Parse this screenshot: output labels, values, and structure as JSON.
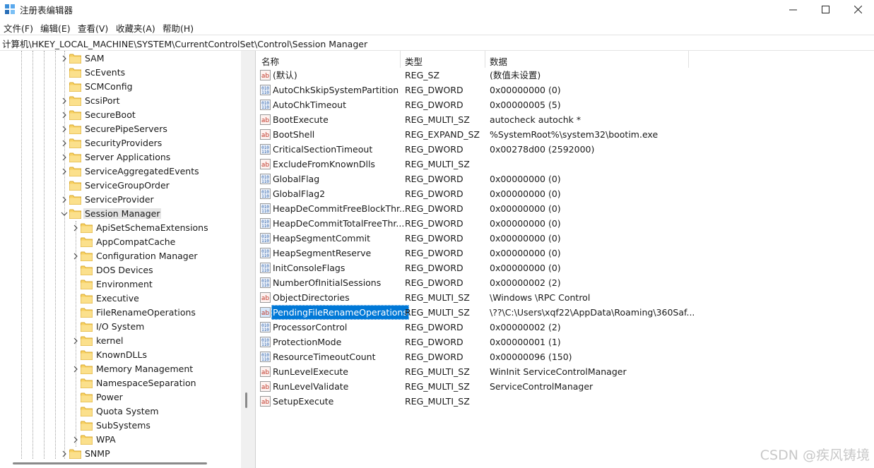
{
  "window": {
    "title": "注册表编辑器",
    "controls": [
      "minimize-icon",
      "maximize-icon",
      "close-icon"
    ]
  },
  "menu": [
    "文件(F)",
    "编辑(E)",
    "查看(V)",
    "收藏夹(A)",
    "帮助(H)"
  ],
  "address": "计算机\\HKEY_LOCAL_MACHINE\\SYSTEM\\CurrentControlSet\\Control\\Session Manager",
  "tree": [
    {
      "label": "SAM",
      "expandable": true,
      "level": 1
    },
    {
      "label": "ScEvents",
      "expandable": false,
      "level": 1
    },
    {
      "label": "SCMConfig",
      "expandable": false,
      "level": 1
    },
    {
      "label": "ScsiPort",
      "expandable": true,
      "level": 1
    },
    {
      "label": "SecureBoot",
      "expandable": true,
      "level": 1
    },
    {
      "label": "SecurePipeServers",
      "expandable": true,
      "level": 1
    },
    {
      "label": "SecurityProviders",
      "expandable": true,
      "level": 1
    },
    {
      "label": "Server Applications",
      "expandable": true,
      "level": 1
    },
    {
      "label": "ServiceAggregatedEvents",
      "expandable": true,
      "level": 1
    },
    {
      "label": "ServiceGroupOrder",
      "expandable": false,
      "level": 1
    },
    {
      "label": "ServiceProvider",
      "expandable": true,
      "level": 1
    },
    {
      "label": "Session Manager",
      "expandable": true,
      "expanded": true,
      "selected": true,
      "level": 1
    },
    {
      "label": "ApiSetSchemaExtensions",
      "expandable": true,
      "level": 2
    },
    {
      "label": "AppCompatCache",
      "expandable": false,
      "level": 2
    },
    {
      "label": "Configuration Manager",
      "expandable": true,
      "level": 2
    },
    {
      "label": "DOS Devices",
      "expandable": false,
      "level": 2
    },
    {
      "label": "Environment",
      "expandable": false,
      "level": 2
    },
    {
      "label": "Executive",
      "expandable": false,
      "level": 2
    },
    {
      "label": "FileRenameOperations",
      "expandable": false,
      "level": 2
    },
    {
      "label": "I/O System",
      "expandable": false,
      "level": 2
    },
    {
      "label": "kernel",
      "expandable": true,
      "level": 2
    },
    {
      "label": "KnownDLLs",
      "expandable": false,
      "level": 2
    },
    {
      "label": "Memory Management",
      "expandable": true,
      "level": 2
    },
    {
      "label": "NamespaceSeparation",
      "expandable": false,
      "level": 2
    },
    {
      "label": "Power",
      "expandable": false,
      "level": 2
    },
    {
      "label": "Quota System",
      "expandable": false,
      "level": 2
    },
    {
      "label": "SubSystems",
      "expandable": false,
      "level": 2
    },
    {
      "label": "WPA",
      "expandable": true,
      "level": 2
    },
    {
      "label": "SNMP",
      "expandable": true,
      "level": 1
    }
  ],
  "columns": {
    "name": "名称",
    "type": "类型",
    "data": "数据"
  },
  "values": [
    {
      "name": "(默认)",
      "type": "REG_SZ",
      "data": "(数值未设置)",
      "icon": "string-value-icon"
    },
    {
      "name": "AutoChkSkipSystemPartition",
      "type": "REG_DWORD",
      "data": "0x00000000 (0)",
      "icon": "binary-value-icon"
    },
    {
      "name": "AutoChkTimeout",
      "type": "REG_DWORD",
      "data": "0x00000005 (5)",
      "icon": "binary-value-icon"
    },
    {
      "name": "BootExecute",
      "type": "REG_MULTI_SZ",
      "data": "autocheck autochk *",
      "icon": "string-value-icon"
    },
    {
      "name": "BootShell",
      "type": "REG_EXPAND_SZ",
      "data": "%SystemRoot%\\system32\\bootim.exe",
      "icon": "string-value-icon"
    },
    {
      "name": "CriticalSectionTimeout",
      "type": "REG_DWORD",
      "data": "0x00278d00 (2592000)",
      "icon": "binary-value-icon"
    },
    {
      "name": "ExcludeFromKnownDlls",
      "type": "REG_MULTI_SZ",
      "data": "",
      "icon": "string-value-icon"
    },
    {
      "name": "GlobalFlag",
      "type": "REG_DWORD",
      "data": "0x00000000 (0)",
      "icon": "binary-value-icon"
    },
    {
      "name": "GlobalFlag2",
      "type": "REG_DWORD",
      "data": "0x00000000 (0)",
      "icon": "binary-value-icon"
    },
    {
      "name": "HeapDeCommitFreeBlockThr...",
      "type": "REG_DWORD",
      "data": "0x00000000 (0)",
      "icon": "binary-value-icon"
    },
    {
      "name": "HeapDeCommitTotalFreeThr...",
      "type": "REG_DWORD",
      "data": "0x00000000 (0)",
      "icon": "binary-value-icon"
    },
    {
      "name": "HeapSegmentCommit",
      "type": "REG_DWORD",
      "data": "0x00000000 (0)",
      "icon": "binary-value-icon"
    },
    {
      "name": "HeapSegmentReserve",
      "type": "REG_DWORD",
      "data": "0x00000000 (0)",
      "icon": "binary-value-icon"
    },
    {
      "name": "InitConsoleFlags",
      "type": "REG_DWORD",
      "data": "0x00000000 (0)",
      "icon": "binary-value-icon"
    },
    {
      "name": "NumberOfInitialSessions",
      "type": "REG_DWORD",
      "data": "0x00000002 (2)",
      "icon": "binary-value-icon"
    },
    {
      "name": "ObjectDirectories",
      "type": "REG_MULTI_SZ",
      "data": "\\Windows \\RPC Control",
      "icon": "string-value-icon"
    },
    {
      "name": "PendingFileRenameOperations",
      "type": "REG_MULTI_SZ",
      "data": "\\??\\C:\\Users\\xqf22\\AppData\\Roaming\\360Saf...",
      "icon": "string-value-icon",
      "selected": true
    },
    {
      "name": "ProcessorControl",
      "type": "REG_DWORD",
      "data": "0x00000002 (2)",
      "icon": "binary-value-icon"
    },
    {
      "name": "ProtectionMode",
      "type": "REG_DWORD",
      "data": "0x00000001 (1)",
      "icon": "binary-value-icon"
    },
    {
      "name": "ResourceTimeoutCount",
      "type": "REG_DWORD",
      "data": "0x00000096 (150)",
      "icon": "binary-value-icon"
    },
    {
      "name": "RunLevelExecute",
      "type": "REG_MULTI_SZ",
      "data": "WinInit ServiceControlManager",
      "icon": "string-value-icon"
    },
    {
      "name": "RunLevelValidate",
      "type": "REG_MULTI_SZ",
      "data": "ServiceControlManager",
      "icon": "string-value-icon"
    },
    {
      "name": "SetupExecute",
      "type": "REG_MULTI_SZ",
      "data": "",
      "icon": "string-value-icon"
    }
  ],
  "watermark": "CSDN @疾风铸境",
  "colors": {
    "selection": "#0078d7",
    "folder": "#f8d264",
    "string_icon": "#c0392b",
    "binary_icon": "#2b5fa8"
  }
}
